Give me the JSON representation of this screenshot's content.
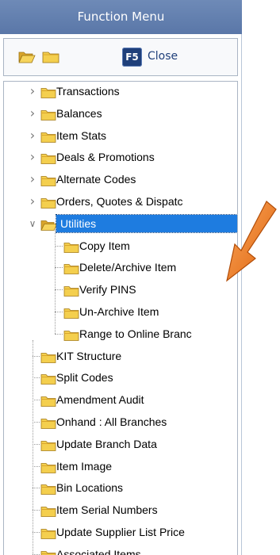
{
  "title": "Function Menu",
  "toolbar": {
    "key_label": "F5",
    "close_label": "Close"
  },
  "tree": {
    "top_items": [
      {
        "label": "Transactions",
        "expanded": false
      },
      {
        "label": "Balances",
        "expanded": false
      },
      {
        "label": "Item Stats",
        "expanded": false
      },
      {
        "label": "Deals & Promotions",
        "expanded": false
      },
      {
        "label": "Alternate Codes",
        "expanded": false
      },
      {
        "label": "Orders, Quotes & Dispatc",
        "expanded": false
      },
      {
        "label": "Utilities",
        "expanded": true,
        "selected": true
      }
    ],
    "utilities_children": [
      {
        "label": "Copy Item"
      },
      {
        "label": "Delete/Archive Item"
      },
      {
        "label": "Verify PINS"
      },
      {
        "label": "Un-Archive Item"
      },
      {
        "label": "Range to Online Branc"
      }
    ],
    "bottom_items": [
      {
        "label": "KIT Structure"
      },
      {
        "label": "Split Codes"
      },
      {
        "label": "Amendment Audit"
      },
      {
        "label": "Onhand : All Branches"
      },
      {
        "label": "Update Branch Data"
      },
      {
        "label": "Item Image"
      },
      {
        "label": "Bin Locations"
      },
      {
        "label": "Item Serial Numbers"
      },
      {
        "label": "Update Supplier List Price"
      },
      {
        "label": "Associated Items"
      }
    ]
  },
  "colors": {
    "title_bar": "#5f7cad",
    "selection": "#1e7ce0",
    "folder": "#f4cf4e",
    "arrow": "#f07a1c"
  }
}
